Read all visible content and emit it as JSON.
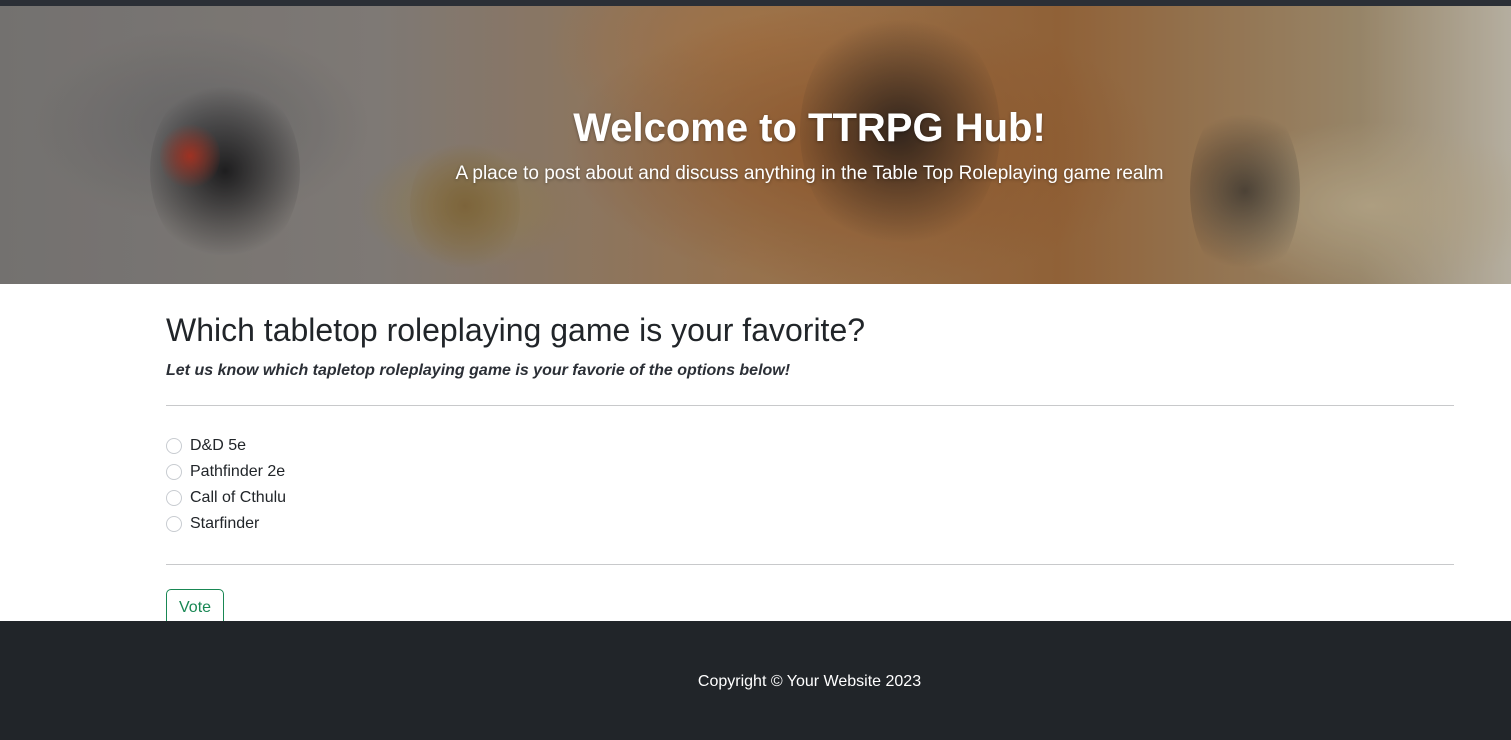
{
  "hero": {
    "title": "Welcome to TTRPG Hub!",
    "subtitle": "A place to post about and discuss anything in the Table Top Roleplaying game realm"
  },
  "poll": {
    "question": "Which tabletop roleplaying game is your favorite?",
    "subtitle": "Let us know which tapletop roleplaying game is your favorie of the options below!",
    "options": [
      {
        "label": "D&D 5e"
      },
      {
        "label": "Pathfinder 2e"
      },
      {
        "label": "Call of Cthulu"
      },
      {
        "label": "Starfinder"
      }
    ],
    "vote_label": "Vote"
  },
  "footer": {
    "copyright": "Copyright © Your Website 2023"
  },
  "colors": {
    "footer_bg": "#212529",
    "vote_accent": "#198754"
  }
}
